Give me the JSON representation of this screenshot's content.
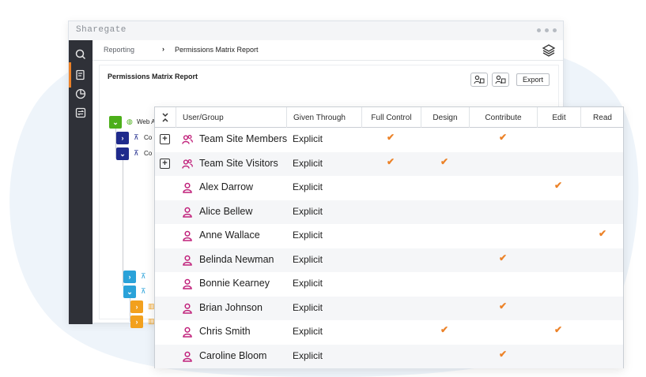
{
  "app": {
    "logo": "Sharegate"
  },
  "breadcrumb": {
    "root": "Reporting",
    "current": "Permissions Matrix Report"
  },
  "report": {
    "title": "Permissions Matrix Report",
    "export_label": "Export"
  },
  "tree": {
    "root_label": "Web Application - Portal",
    "partial_labels": [
      "Co",
      "Co"
    ]
  },
  "matrix": {
    "columns": [
      "User/Group",
      "Given Through",
      "Full Control",
      "Design",
      "Contribute",
      "Edit",
      "Read"
    ],
    "rows": [
      {
        "name": "Team Site Members",
        "through": "Explicit",
        "type": "group",
        "perms": [
          true,
          false,
          true,
          false,
          false
        ]
      },
      {
        "name": "Team Site Visitors",
        "through": "Explicit",
        "type": "group",
        "perms": [
          true,
          true,
          false,
          false,
          false
        ]
      },
      {
        "name": "Alex Darrow",
        "through": "Explicit",
        "type": "user",
        "perms": [
          false,
          false,
          false,
          true,
          false
        ]
      },
      {
        "name": "Alice Bellew",
        "through": "Explicit",
        "type": "user",
        "perms": [
          false,
          false,
          false,
          false,
          false
        ]
      },
      {
        "name": "Anne Wallace",
        "through": "Explicit",
        "type": "user",
        "perms": [
          false,
          false,
          false,
          false,
          true
        ]
      },
      {
        "name": "Belinda Newman",
        "through": "Explicit",
        "type": "user",
        "perms": [
          false,
          false,
          true,
          false,
          false
        ]
      },
      {
        "name": "Bonnie Kearney",
        "through": "Explicit",
        "type": "user",
        "perms": [
          false,
          false,
          false,
          false,
          false
        ]
      },
      {
        "name": "Brian Johnson",
        "through": "Explicit",
        "type": "user",
        "perms": [
          false,
          false,
          true,
          false,
          false
        ]
      },
      {
        "name": "Chris Smith",
        "through": "Explicit",
        "type": "user",
        "perms": [
          false,
          true,
          false,
          true,
          false
        ]
      },
      {
        "name": "Caroline Bloom",
        "through": "Explicit",
        "type": "user",
        "perms": [
          false,
          false,
          true,
          false,
          false
        ]
      }
    ]
  },
  "icons": {
    "check": "✔",
    "expand": "+",
    "chevron_right": "›",
    "chevron_down": "⌄"
  },
  "colors": {
    "accent": "#ec8228",
    "user_icon": "#c0207a",
    "sidebar": "#2f3138",
    "tree_green": "#4caf1a",
    "tree_navy": "#1f2a8c",
    "tree_blue": "#2aa2d9",
    "tree_orange": "#f2a01d"
  }
}
